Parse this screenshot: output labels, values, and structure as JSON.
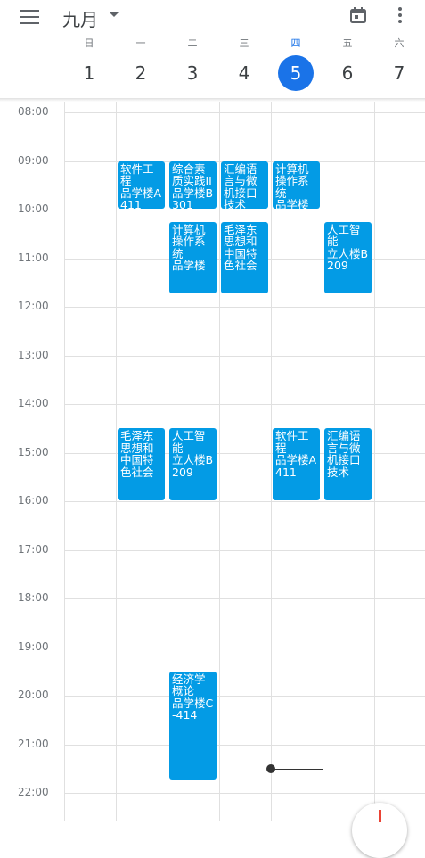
{
  "header": {
    "month": "九月",
    "icons": {
      "menu": "hamburger-icon",
      "dropdown": "chevron-down-icon",
      "today": "calendar-today-icon",
      "more": "more-vert-icon"
    }
  },
  "days": [
    {
      "weekday": "日",
      "date": "1"
    },
    {
      "weekday": "一",
      "date": "2"
    },
    {
      "weekday": "二",
      "date": "3"
    },
    {
      "weekday": "三",
      "date": "4"
    },
    {
      "weekday": "四",
      "date": "5",
      "today": true
    },
    {
      "weekday": "五",
      "date": "6"
    },
    {
      "weekday": "六",
      "date": "7"
    }
  ],
  "times": [
    "08:00",
    "09:00",
    "10:00",
    "11:00",
    "12:00",
    "13:00",
    "14:00",
    "15:00",
    "16:00",
    "17:00",
    "18:00",
    "19:00",
    "20:00",
    "21:00",
    "22:00"
  ],
  "events": [
    {
      "day": 1,
      "start": "09:00",
      "end": "10:00",
      "title": "软件工程",
      "location": "品学楼A411"
    },
    {
      "day": 2,
      "start": "09:00",
      "end": "10:00",
      "title": "综合素质实践II",
      "location": "品学楼B301"
    },
    {
      "day": 3,
      "start": "09:00",
      "end": "10:00",
      "title": "汇编语言与微机接口技术",
      "location": ""
    },
    {
      "day": 4,
      "start": "09:00",
      "end": "10:00",
      "title": "计算机操作系统",
      "location": "品学楼"
    },
    {
      "day": 2,
      "start": "10:15",
      "end": "11:45",
      "title": "计算机操作系统",
      "location": "品学楼"
    },
    {
      "day": 3,
      "start": "10:15",
      "end": "11:45",
      "title": "毛泽东思想和中国特色社会",
      "location": ""
    },
    {
      "day": 5,
      "start": "10:15",
      "end": "11:45",
      "title": "人工智能",
      "location": "立人楼B209"
    },
    {
      "day": 1,
      "start": "14:30",
      "end": "16:00",
      "title": "毛泽东思想和中国特色社会",
      "location": ""
    },
    {
      "day": 2,
      "start": "14:30",
      "end": "16:00",
      "title": "人工智能",
      "location": "立人楼B209"
    },
    {
      "day": 4,
      "start": "14:30",
      "end": "16:00",
      "title": "软件工程",
      "location": "品学楼A411"
    },
    {
      "day": 5,
      "start": "14:30",
      "end": "16:00",
      "title": "汇编语言与微机接口技术",
      "location": ""
    },
    {
      "day": 2,
      "start": "19:30",
      "end": "21:45",
      "title": "经济学概论",
      "location": "品学楼C-414"
    }
  ],
  "now": {
    "day": 4,
    "time": "21:30"
  },
  "fab_icon": "add-icon"
}
